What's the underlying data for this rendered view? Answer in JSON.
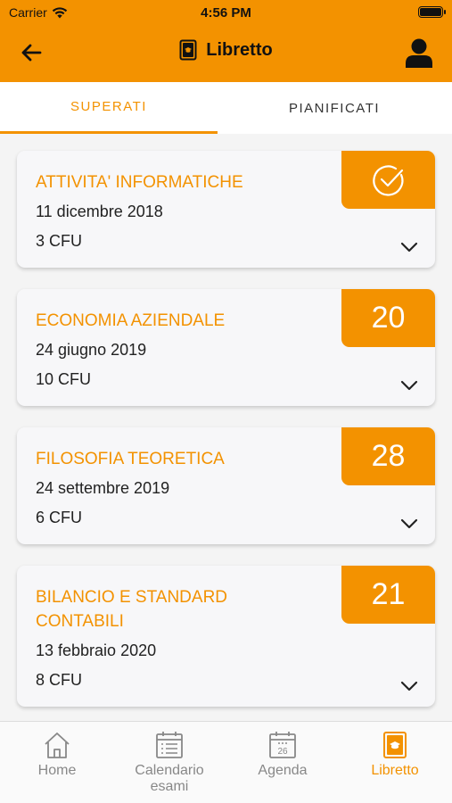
{
  "status_bar": {
    "carrier": "Carrier",
    "time": "4:56 PM"
  },
  "header": {
    "title": "Libretto",
    "back_icon": "arrow-left-icon",
    "profile_icon": "user-icon"
  },
  "tabs": [
    {
      "label": "SUPERATI",
      "active": true
    },
    {
      "label": "PIANIFICATI",
      "active": false
    }
  ],
  "exams": [
    {
      "name": "ATTIVITA' INFORMATICHE",
      "date": "11 dicembre 2018",
      "cfu": "3 CFU",
      "grade": "",
      "grade_icon": "check-circle-icon"
    },
    {
      "name": "ECONOMIA AZIENDALE",
      "date": "24 giugno 2019",
      "cfu": "10 CFU",
      "grade": "20"
    },
    {
      "name": "FILOSOFIA TEORETICA",
      "date": "24 settembre 2019",
      "cfu": "6 CFU",
      "grade": "28"
    },
    {
      "name": "BILANCIO E STANDARD CONTABILI",
      "date": "13 febbraio 2020",
      "cfu": "8 CFU",
      "grade": "21"
    }
  ],
  "bottom_nav": [
    {
      "label": "Home",
      "icon": "home-icon",
      "active": false
    },
    {
      "label": "Calendario esami",
      "icon": "calendar-list-icon",
      "active": false
    },
    {
      "label": "Agenda",
      "icon": "calendar-26-icon",
      "calendar_day": "26",
      "active": false
    },
    {
      "label": "Libretto",
      "icon": "booklet-icon",
      "active": true
    }
  ],
  "colors": {
    "accent": "#f39200",
    "background": "#f4f4f4",
    "card": "#f7f7f9"
  }
}
